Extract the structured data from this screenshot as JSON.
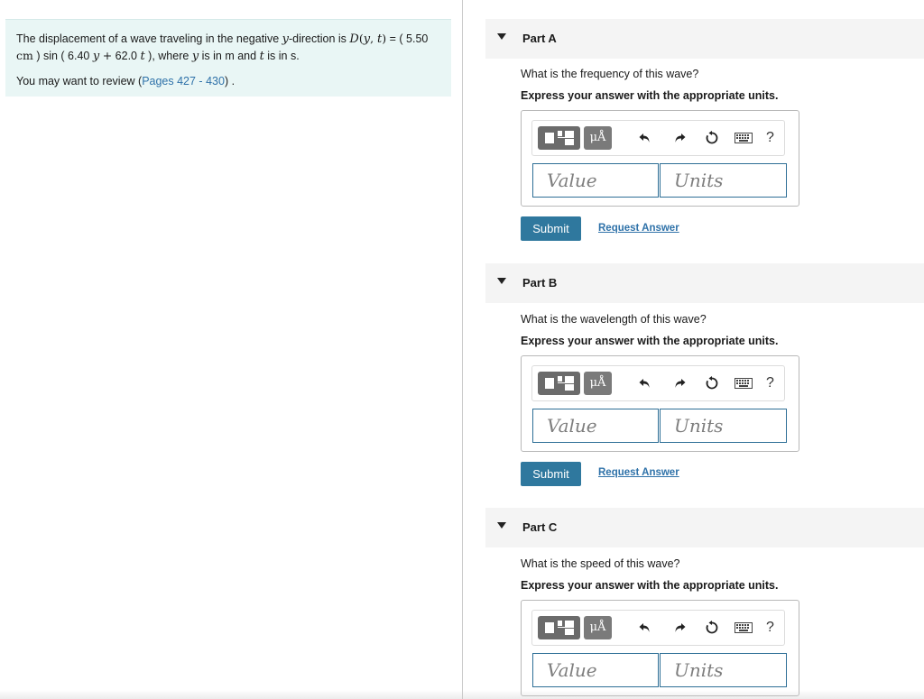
{
  "problem": {
    "text_1": "The displacement of a wave traveling in the negative ",
    "y": "y",
    "text_2": "-direction is ",
    "D": "D",
    "paren_open": "(",
    "t": "t",
    "comma": ", ",
    "paren_close": ")",
    "text_3": " = ( 5.50",
    "cm": "cm",
    "text_4": " ) sin ( 6.40 ",
    "plus": "+",
    "text_5": " 62.0 ",
    "text_6": " ), where ",
    "text_7": " is in m and ",
    "text_8": " is in s.",
    "review_prefix": "You may want to review (",
    "review_link": "Pages 427 - 430",
    "review_suffix": ") ."
  },
  "parts": [
    {
      "title": "Part A",
      "question": "What is the frequency of this wave?",
      "instruction": "Express your answer with the appropriate units.",
      "value_placeholder": "Value",
      "units_placeholder": "Units",
      "submit_label": "Submit",
      "request_label": "Request Answer"
    },
    {
      "title": "Part B",
      "question": "What is the wavelength of this wave?",
      "instruction": "Express your answer with the appropriate units.",
      "value_placeholder": "Value",
      "units_placeholder": "Units",
      "submit_label": "Submit",
      "request_label": "Request Answer"
    },
    {
      "title": "Part C",
      "question": "What is the speed of this wave?",
      "instruction": "Express your answer with the appropriate units.",
      "value_placeholder": "Value",
      "units_placeholder": "Units"
    }
  ],
  "toolbar": {
    "units_symbol": "μÅ",
    "help": "?",
    "icons": [
      "templates-icon",
      "units-icon",
      "undo-icon",
      "redo-icon",
      "reset-icon",
      "keyboard-icon",
      "help-icon"
    ]
  },
  "colors": {
    "problem_bg": "#e9f6f5",
    "link": "#2f72a9",
    "submit_bg": "#2f789e",
    "field_border": "#2e6f96",
    "part_header_bg": "#f4f4f4"
  }
}
